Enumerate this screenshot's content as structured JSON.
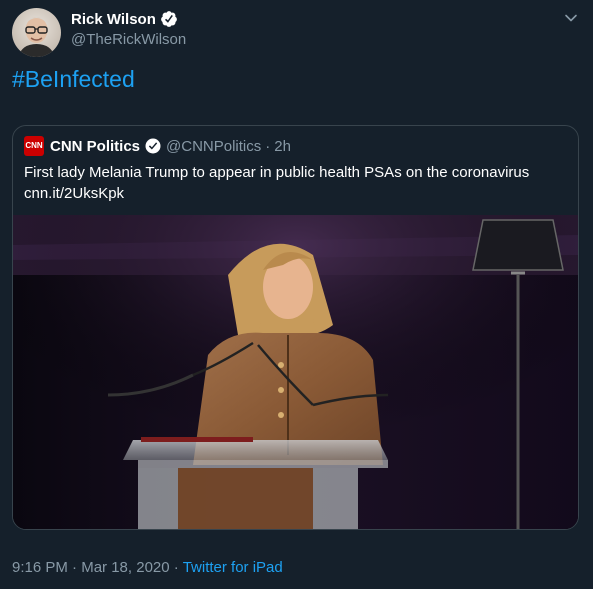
{
  "author": {
    "display_name": "Rick Wilson",
    "handle": "@TheRickWilson",
    "avatar_icon": "avatar-photo",
    "verified_icon": "verified-badge-icon"
  },
  "tweet": {
    "text": "#BeInfected"
  },
  "quoted": {
    "logo_text": "CNN",
    "display_name": "CNN Politics",
    "handle": "@CNNPolitics",
    "separator": "·",
    "time": "2h",
    "text_line1": "First lady Melania Trump to appear in public health PSAs on the coronavirus",
    "text_line2": "cnn.it/2UksKpk"
  },
  "footer": {
    "time": "9:16 PM",
    "separator1": "·",
    "date": "Mar 18, 2020",
    "separator2": "·",
    "source": "Twitter for iPad"
  },
  "colors": {
    "background": "#15202b",
    "link": "#1da1f2",
    "muted": "#8899a6",
    "border": "#38444d"
  }
}
